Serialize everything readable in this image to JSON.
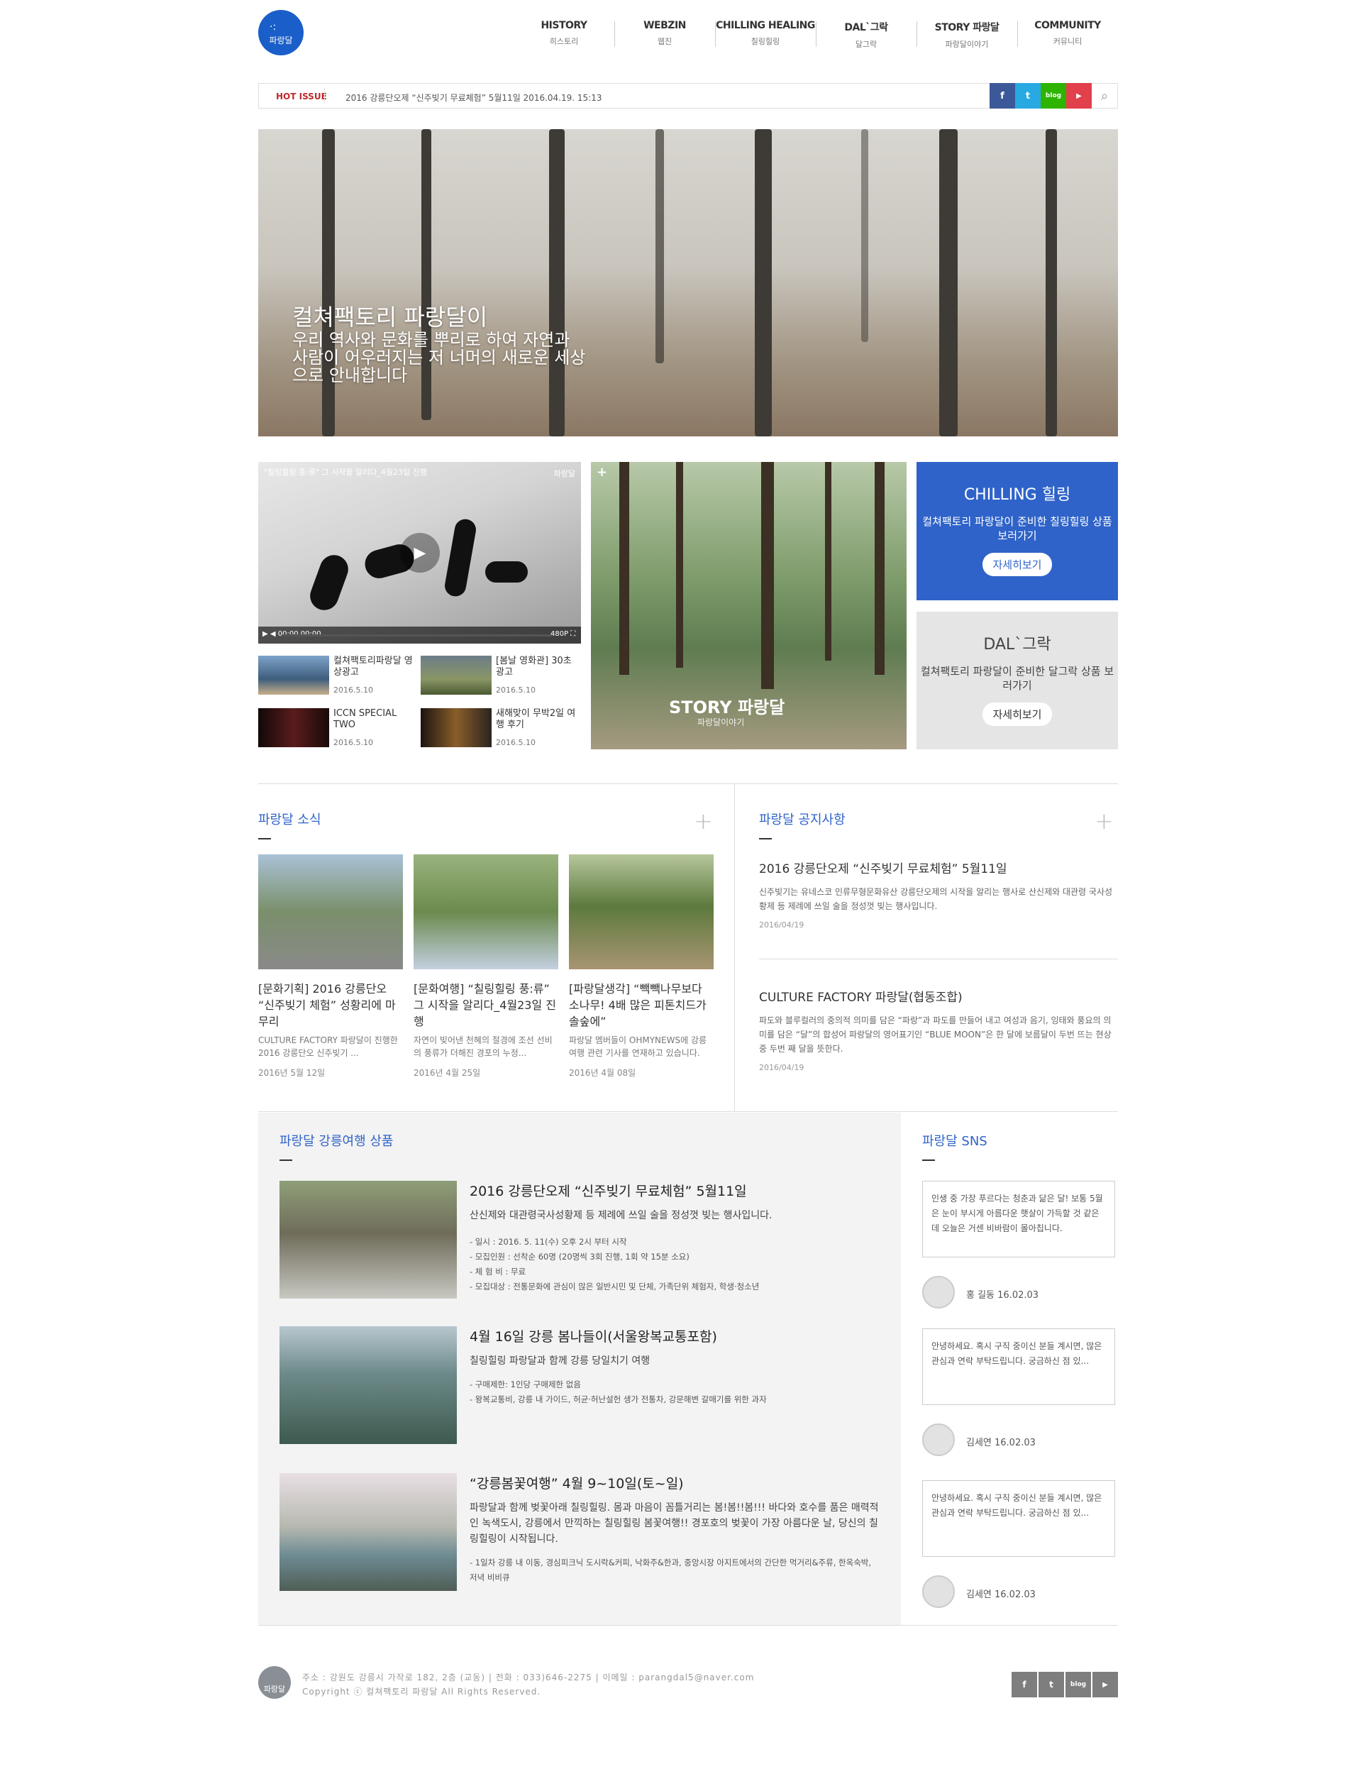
{
  "header": {
    "logo": "파랑달",
    "nav": [
      {
        "en": "HISTORY",
        "ko": "히스토리"
      },
      {
        "en": "WEBZIN",
        "ko": "웹진"
      },
      {
        "en": "CHILLING HEALING",
        "ko": "칠링힐링"
      },
      {
        "en": "DAL`그락",
        "ko": "달그락"
      },
      {
        "en": "STORY 파랑달",
        "ko": "파랑달이야기"
      },
      {
        "en": "COMMUNITY",
        "ko": "커뮤니티"
      }
    ]
  },
  "hot_issue": {
    "tag": "HOT ISSUE",
    "text": "2016 강릉단오제 “신주빚기 무료체험” 5월11일 2016.04.19. 15:13",
    "social": [
      "f",
      "t",
      "blog",
      "▶"
    ]
  },
  "hero": {
    "title": "컬쳐팩토리 파랑달이",
    "subtitle": "우리 역사와 문화를 뿌리로 하여 자연과 사람이 어우러지는 저 너머의 새로운 세상으로 안내합니다"
  },
  "video": {
    "title": "\"칠링힐링 풍:류\" 그 시작을 알리다_4월23일 진행",
    "corner": "파랑달",
    "controls": "▶ ◀ 00:00  00:00",
    "quality": "480P ⛶"
  },
  "thumbs": [
    {
      "title": "컬쳐팩토리파랑달 영상광고",
      "date": "2016.5.10",
      "color": "#5b7fa8"
    },
    {
      "title": "[봄날 영화관] 30초 광고",
      "date": "2016.5.10",
      "color": "#6a7a58"
    },
    {
      "title": "ICCN SPECIAL TWO",
      "date": "2016.5.10",
      "color": "#3a1a1a"
    },
    {
      "title": "새해맞이 무박2일 여행 후기",
      "date": "2016.5.10",
      "color": "#2b2420"
    }
  ],
  "story": {
    "label": "STORY 파랑달",
    "sub": "파랑달이야기",
    "plus": "+"
  },
  "cards": [
    {
      "title": "CHILLING 힐링",
      "desc": "컬쳐팩토리 파랑달이 준비한 칠링힐링 상품 보러가기",
      "btn": "자세히보기"
    },
    {
      "title": "DAL`그락",
      "desc": "컬쳐팩토리 파랑달이 준비한 달그락 상품 보러가기",
      "btn": "자세히보기"
    }
  ],
  "news_section": {
    "title": "파랑달 소식",
    "plus": "+"
  },
  "news": [
    {
      "title": "[문화기획] 2016 강릉단오 “신주빚기 체험” 성황리에 마무리",
      "summary": "CULTURE FACTORY 파랑달이 진행한 2016 강릉단오 신주빚기 ...",
      "date": "2016년 5월 12일",
      "color": "#8fa7b8"
    },
    {
      "title": "[문화여행] “칠링힐링 풍:류” 그 시작을 알리다_4월23일 진행",
      "summary": "자연이 빚어낸 천혜의 절경에 조선 선비의 풍류가 더해진 경포의 누정...",
      "date": "2016년 4월 25일",
      "color": "#7d9a66"
    },
    {
      "title": "[파랑달생각] “빽빽나무보다 소나무! 4배 많은 피톤치드가 솔숲에”",
      "summary": "파랑달 멤버들이 OHMYNEWS에 강릉 여행 관련 기사를 연재하고 있습니다.",
      "date": "2016년 4월 08일",
      "color": "#6a8a52"
    }
  ],
  "notice_section": {
    "title": "파랑달 공지사항",
    "plus": "+"
  },
  "notices": [
    {
      "title": "2016 강릉단오제 “신주빚기 무료체험” 5월11일",
      "summary": "신주빚기는 유네스코 인류무형문화유산 강릉단오제의 시작을 알리는 행사로 산신제와 대관령 국사성황제 등 제례에 쓰일 술을 정성껏 빚는 행사입니다.",
      "date": "2016/04/19"
    },
    {
      "title": "CULTURE FACTORY 파랑달(협동조합)",
      "summary": "파도와 블루컬러의 중의적 의미를 담은 “파랑”과 파도를 만들어 내고 여성과 음기, 잉태와 풍요의 의미를 담은 “달”의 합성어 파랑달의 영어표기인 “BLUE MOON”은 한 달에 보름달이 두번 뜨는 현상 중 두번 째 달을 뜻한다.",
      "date": "2016/04/19"
    }
  ],
  "products_section": {
    "title": "파랑달 강릉여행 상품"
  },
  "products": [
    {
      "title": "2016 강릉단오제 “신주빚기 무료체험” 5월11일",
      "desc": "산신제와 대관령국사성황제 등 제례에 쓰일 술을 정성껏 빚는 행사입니다.",
      "items": [
        "- 일시 : 2016. 5. 11(수) 오후 2시 부터 시작",
        "- 모집인원 : 선착순 60명 (20명씩 3회 진행, 1회 약 15분 소요)",
        "- 체 험 비 : 무료",
        "- 모집대상 : 전통문화에 관심이 많은 일반시민 및 단체, 가족단위 체험자, 학생·청소년"
      ],
      "color": "#8d8670"
    },
    {
      "title": "4월 16일 강릉 봄나들이(서울왕복교통포함)",
      "desc": "칠링힐링 파랑달과 함께 강릉 당일치기 여행",
      "items": [
        "- 구매제한: 1인당 구매제한 없음",
        "- 왕복교통비, 강릉 내 가이드, 허균·허난설헌 생가 전통차, 강문해변 갈매기를 위한 과자"
      ],
      "color": "#5f7b78"
    },
    {
      "title": "“강릉봄꽃여행” 4월 9~10일(토~일)",
      "desc": "파랑달과 함께 벚꽃아래 칠링힐링. 몸과 마음이 꼼틀거리는 봄!봄!!봄!!! 바다와 호수를 품은 매력적인 녹색도시, 강릉에서 만끽하는 칠링힐링 봄꽃여행!! 경포호의 벚꽃이 가장 아름다운 날, 당신의 칠링힐링이 시작됩니다.",
      "items": [
        "- 1일차 강릉 내 이동, 경심피크닉 도시락&커피, 낙화주&한과, 중앙시장 아지트에서의 간단한 먹거리&주류, 한옥숙박, 저녁 비비큐"
      ],
      "color": "#7a8a88"
    }
  ],
  "sns_section": {
    "title": "파랑달 SNS"
  },
  "sns": [
    {
      "text": "인생 중 가장 푸르다는 청춘과 닮은 달! 보통 5월은 눈이 부시게 아름다운 햇살이 가득할 것 같은데 오늘은 거센 비바람이 몰아칩니다.",
      "user": "홍 길동 16.02.03"
    },
    {
      "text": "안녕하세요. 혹시 구직 중이신 분들 계시면, 많은 관심과 연락 부탁드립니다. 궁금하신 점 있...",
      "user": "김세연 16.02.03"
    },
    {
      "text": "안녕하세요. 혹시 구직 중이신 분들 계시면, 많은 관심과 연락 부탁드립니다. 궁금하신 점 있...",
      "user": "김세연 16.02.03"
    }
  ],
  "footer": {
    "logo": "파랑달",
    "address": "주소 : 강원도 강릉시 가작로 182, 2층 (교동) | 전화 : 033)646-2275 | 이메일 : parangdal5@naver.com",
    "copyright": "Copyright ⓒ 컬쳐팩토리 파랑달 All Rights Reserved.",
    "social": [
      "f",
      "t",
      "blog",
      "▶"
    ]
  }
}
